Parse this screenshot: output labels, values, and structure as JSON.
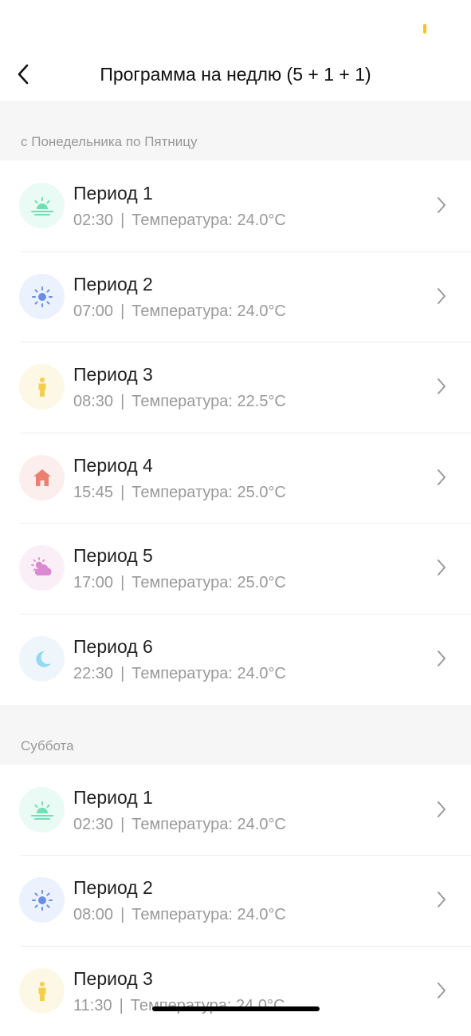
{
  "header": {
    "title": "Программа на недлю (5 + 1 + 1)"
  },
  "sections": [
    {
      "label": "с Понедельника по Пятницу",
      "items": [
        {
          "title": "Период 1",
          "time": "02:30",
          "separator": "|",
          "temp": "Температура: 24.0°C",
          "icon": "sunrise-icon"
        },
        {
          "title": "Период 2",
          "time": "07:00",
          "separator": "|",
          "temp": "Температура: 24.0°C",
          "icon": "sun-icon"
        },
        {
          "title": "Период 3",
          "time": "08:30",
          "separator": "|",
          "temp": "Температура: 22.5°C",
          "icon": "person-icon"
        },
        {
          "title": "Период 4",
          "time": "15:45",
          "separator": "|",
          "temp": "Температура: 25.0°C",
          "icon": "home-icon"
        },
        {
          "title": "Период 5",
          "time": "17:00",
          "separator": "|",
          "temp": "Температура: 25.0°C",
          "icon": "cloud-sun-icon"
        },
        {
          "title": "Период 6",
          "time": "22:30",
          "separator": "|",
          "temp": "Температура: 24.0°C",
          "icon": "moon-icon"
        }
      ]
    },
    {
      "label": "Суббота",
      "items": [
        {
          "title": "Период 1",
          "time": "02:30",
          "separator": "|",
          "temp": "Температура: 24.0°C",
          "icon": "sunrise-icon"
        },
        {
          "title": "Период 2",
          "time": "08:00",
          "separator": "|",
          "temp": "Температура: 24.0°C",
          "icon": "sun-icon"
        },
        {
          "title": "Период 3",
          "time": "11:30",
          "separator": "|",
          "temp": "Температура: 24.0°C",
          "icon": "person-icon"
        }
      ]
    }
  ],
  "colors": {
    "sunrise": "#6fe0b6",
    "sun": "#6a8ee8",
    "person": "#f3cf4e",
    "home": "#ec8070",
    "cloud": "#d98ad0",
    "moon": "#94d8f4",
    "status_accent": "#f5c518"
  }
}
